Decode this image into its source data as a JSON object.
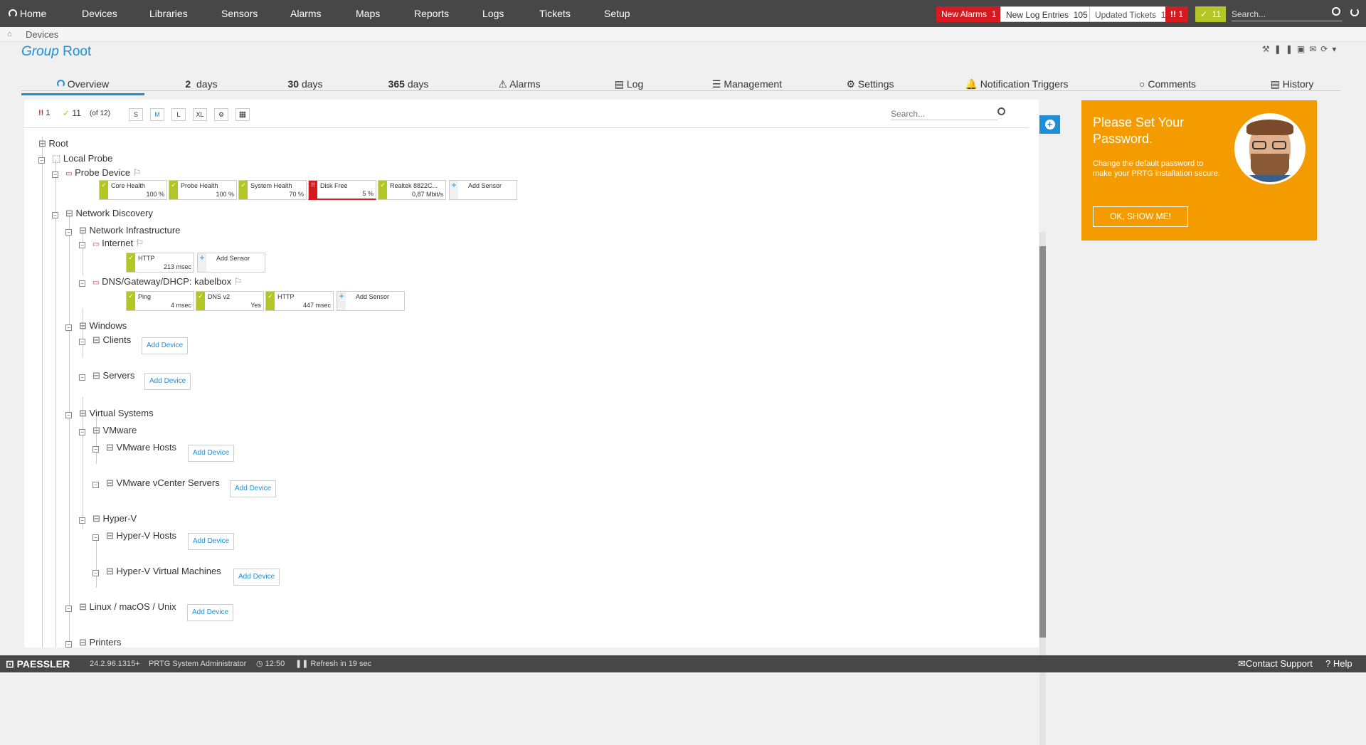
{
  "nav": {
    "home": "Home",
    "items": [
      "Devices",
      "Libraries",
      "Sensors",
      "Alarms",
      "Maps",
      "Reports",
      "Logs",
      "Tickets",
      "Setup"
    ],
    "new_alarms_label": "New Alarms",
    "new_alarms_count": "1",
    "new_log_label": "New Log Entries",
    "new_log_count": "105",
    "updated_tickets_label": "Updated Tickets",
    "updated_tickets_count": "1",
    "alarm_badge": "1",
    "ok_badge": "11",
    "search_placeholder": "Search..."
  },
  "breadcrumb": {
    "item": "Devices"
  },
  "page": {
    "title_prefix": "Group",
    "title": "Root"
  },
  "tabs": {
    "overview": "Overview",
    "d2_num": "2",
    "d2_unit": "days",
    "d30_num": "30",
    "d30_unit": "days",
    "d365_num": "365",
    "d365_unit": "days",
    "alarms": "Alarms",
    "log": "Log",
    "management": "Management",
    "settings": "Settings",
    "notifications": "Notification Triggers",
    "comments": "Comments",
    "history": "History"
  },
  "toolbar": {
    "alarm_count": "1",
    "ok_count": "11",
    "of_total": "(of 12)",
    "sizes": [
      "S",
      "M",
      "L",
      "XL"
    ],
    "search_placeholder": "Search..."
  },
  "tree": {
    "root": "Root",
    "local_probe": "Local Probe",
    "probe_device": "Probe Device",
    "network_discovery": "Network Discovery",
    "network_infrastructure": "Network Infrastructure",
    "internet": "Internet",
    "dns": "DNS/Gateway/DHCP: kabelbox",
    "windows": "Windows",
    "clients": "Clients",
    "servers": "Servers",
    "virtual_systems": "Virtual Systems",
    "vmware": "VMware",
    "vmware_hosts": "VMware Hosts",
    "vmware_vcenter": "VMware vCenter Servers",
    "hyperv": "Hyper-V",
    "hyperv_hosts": "Hyper-V Hosts",
    "hyperv_vms": "Hyper-V Virtual Machines",
    "linux": "Linux / macOS / Unix",
    "printers": "Printers",
    "add_device": "Add Device",
    "add_sensor": "Add Sensor"
  },
  "sensors": {
    "probe": [
      {
        "name": "Core Health",
        "value": "100 %",
        "status": "up"
      },
      {
        "name": "Probe Health",
        "value": "100 %",
        "status": "up"
      },
      {
        "name": "System Health",
        "value": "70 %",
        "status": "up"
      },
      {
        "name": "Disk Free",
        "value": "5 %",
        "status": "down"
      },
      {
        "name": "Realtek 8822C...",
        "value": "0,87 Mbit/s",
        "status": "up"
      }
    ],
    "internet": [
      {
        "name": "HTTP",
        "value": "213 msec",
        "status": "up"
      }
    ],
    "dns": [
      {
        "name": "Ping",
        "value": "4 msec",
        "status": "up"
      },
      {
        "name": "DNS v2",
        "value": "Yes",
        "status": "up"
      },
      {
        "name": "HTTP",
        "value": "447 msec",
        "status": "up"
      }
    ]
  },
  "promo": {
    "title": "Please Set Your Password.",
    "text": "Change the default password to make your PRTG installation secure.",
    "button": "OK, SHOW ME!"
  },
  "footer": {
    "brand": "PAESSLER",
    "version": "24.2.96.1315+",
    "user": "PRTG System Administrator",
    "time": "12:50",
    "refresh": "Refresh in 19 sec",
    "contact": "Contact Support",
    "help": "Help"
  },
  "colors": {
    "accent": "#1e8fd6",
    "ok": "#b4c626",
    "error": "#d71920",
    "promo": "#f49b00",
    "topbar": "#474747"
  }
}
